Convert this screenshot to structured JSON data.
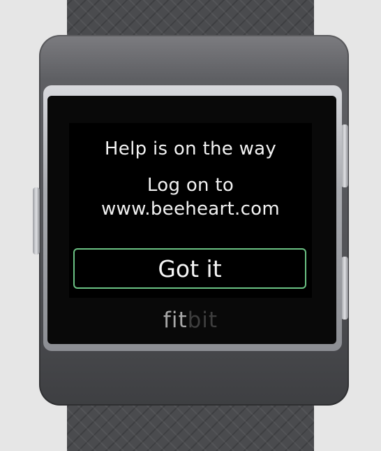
{
  "screen": {
    "heading": "Help is on the way",
    "instruction_line1": "Log on to",
    "instruction_line2": "www.beeheart.com",
    "button_label": "Got it"
  },
  "device": {
    "logo_part1": "fit",
    "logo_part2": "bit"
  },
  "colors": {
    "screen_background": "#000000",
    "button_border": "#6bc284",
    "text": "#f2f2f2"
  }
}
